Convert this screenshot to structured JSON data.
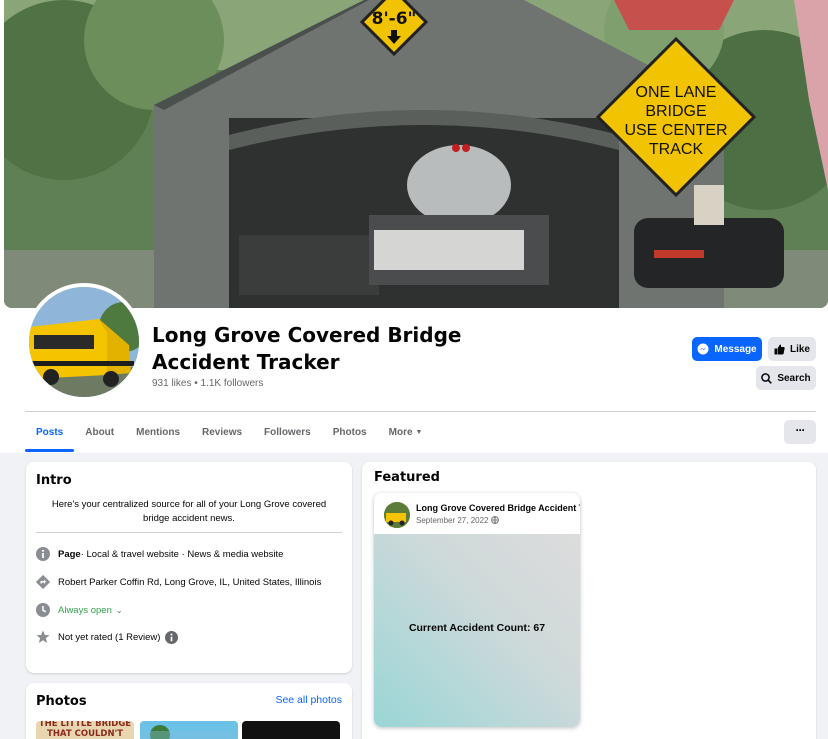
{
  "cover": {
    "sign_height": "8'-6\"",
    "sign_lines": [
      "ONE LANE",
      "BRIDGE",
      "USE CENTER",
      "TRACK"
    ]
  },
  "page": {
    "title": "Long Grove Covered Bridge Accident Tracker",
    "stats": "931 likes • 1.1K followers"
  },
  "actions": {
    "message": "Message",
    "like": "Like",
    "search": "Search",
    "more_dots": "···"
  },
  "tabs": [
    {
      "label": "Posts",
      "active": true
    },
    {
      "label": "About"
    },
    {
      "label": "Mentions"
    },
    {
      "label": "Reviews"
    },
    {
      "label": "Followers"
    },
    {
      "label": "Photos"
    },
    {
      "label": "More",
      "caret": "▼"
    }
  ],
  "intro": {
    "heading": "Intro",
    "description": "Here's your centralized source for all of your Long Grove covered bridge accident news.",
    "category_prefix": "Page",
    "category": " · Local & travel website · News & media website",
    "address": "Robert Parker Coffin Rd, Long Grove, IL, United States, Illinois",
    "hours": "Always open",
    "hours_caret": "⌄",
    "rating": "Not yet rated (1 Review)"
  },
  "photos": {
    "heading": "Photos",
    "see_all": "See all photos",
    "thumb1_text": "THE LITTLE BRIDGE THAT COULDN'T"
  },
  "featured": {
    "heading": "Featured",
    "post_author": "Long Grove Covered Bridge Accident Tracker",
    "post_date": "September 27, 2022",
    "post_text": "Current Accident Count: 67"
  },
  "colors": {
    "primary": "#0866ff",
    "open_green": "#31a24c",
    "bus_yellow": "#f5c400",
    "sign_yellow": "#f2c300"
  }
}
